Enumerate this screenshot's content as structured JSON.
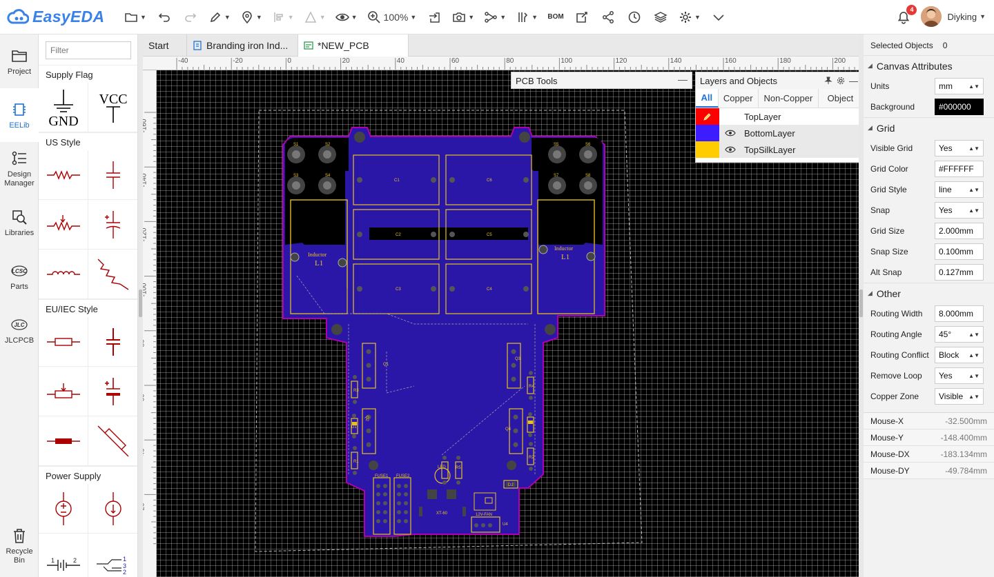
{
  "app": {
    "name": "EasyEDA"
  },
  "toolbar": {
    "zoom": "100%",
    "bom": "BOM"
  },
  "user": {
    "name": "Diyking",
    "notifications": "4"
  },
  "leftnav": {
    "items": [
      {
        "label": "Project",
        "icon": "folder-icon"
      },
      {
        "label": "EELib",
        "icon": "chip-icon"
      },
      {
        "label": "Design Manager",
        "icon": "design-manager-icon"
      },
      {
        "label": "Libraries",
        "icon": "libraries-icon"
      },
      {
        "label": "Parts",
        "icon": "lcsc-icon"
      },
      {
        "label": "JLCPCB",
        "icon": "jlc-icon"
      }
    ],
    "recycle": "Recycle Bin"
  },
  "library": {
    "filter_placeholder": "Filter",
    "sections": [
      "Supply Flag",
      "US Style",
      "EU/IEC Style",
      "Power Supply"
    ],
    "gnd": "GND",
    "vcc": "VCC"
  },
  "tabs": [
    {
      "label": "Start"
    },
    {
      "label": "Branding iron Ind..."
    },
    {
      "label": "*NEW_PCB"
    }
  ],
  "ruler": {
    "top": [
      "-40",
      "-20",
      "0",
      "20",
      "40",
      "60",
      "80",
      "100",
      "120",
      "140",
      "160",
      "180",
      "200"
    ],
    "left": [
      "-160",
      "-140",
      "-120",
      "-100",
      "-80",
      "-60",
      "-40",
      "-20"
    ]
  },
  "pcb_tools": {
    "title": "PCB Tools"
  },
  "layers_panel": {
    "title": "Layers and Objects",
    "tabs": [
      "All",
      "Copper",
      "Non-Copper",
      "Object"
    ],
    "rows": [
      {
        "name": "TopLayer",
        "color": "#ff0000"
      },
      {
        "name": "BottomLayer",
        "color": "#3d1cff"
      },
      {
        "name": "TopSilkLayer",
        "color": "#ffcc00"
      }
    ]
  },
  "right_panel": {
    "selected_label": "Selected Objects",
    "selected_count": "0",
    "canvas_title": "Canvas Attributes",
    "units_label": "Units",
    "units": "mm",
    "background_label": "Background",
    "background": "#000000",
    "grid_title": "Grid",
    "visible_grid_label": "Visible Grid",
    "visible_grid": "Yes",
    "grid_color_label": "Grid Color",
    "grid_color": "#FFFFFF",
    "grid_style_label": "Grid Style",
    "grid_style": "line",
    "snap_label": "Snap",
    "snap": "Yes",
    "grid_size_label": "Grid Size",
    "grid_size": "2.000mm",
    "snap_size_label": "Snap Size",
    "snap_size": "0.100mm",
    "alt_snap_label": "Alt Snap",
    "alt_snap": "0.127mm",
    "other_title": "Other",
    "routing_width_label": "Routing Width",
    "routing_width": "8.000mm",
    "routing_angle_label": "Routing Angle",
    "routing_angle": "45°",
    "routing_conflict_label": "Routing Conflict",
    "routing_conflict": "Block",
    "remove_loop_label": "Remove Loop",
    "remove_loop": "Yes",
    "copper_zone_label": "Copper Zone",
    "copper_zone": "Visible",
    "mouse": [
      {
        "label": "Mouse-X",
        "value": "-32.500mm"
      },
      {
        "label": "Mouse-Y",
        "value": "-148.400mm"
      },
      {
        "label": "Mouse-DX",
        "value": "-183.134mm"
      },
      {
        "label": "Mouse-DY",
        "value": "-49.784mm"
      }
    ]
  },
  "pcb_labels": {
    "s1": "S1",
    "s2": "S2",
    "s3": "S3",
    "s4": "S4",
    "s5": "S5",
    "s6": "S6",
    "s7": "S7",
    "s8": "S8",
    "c1": "C1",
    "c2": "C2",
    "c3": "C3",
    "c4": "C4",
    "c5": "C5",
    "c6": "C6",
    "inductor": "Inductor",
    "l1": "L1",
    "q1": "Q1",
    "q2": "Q2",
    "q3": "Q3",
    "q4": "Q4",
    "r1": "R1",
    "r2": "R2",
    "r3": "R3",
    "r4": "R4",
    "r5": "R5",
    "d1": "D1",
    "d2": "D2",
    "fuse1": "FUSE1",
    "fuse2": "FUSE2",
    "led": "LED",
    "xt60": "XT-60",
    "fan": "12V-FAN",
    "u4": "U4"
  }
}
